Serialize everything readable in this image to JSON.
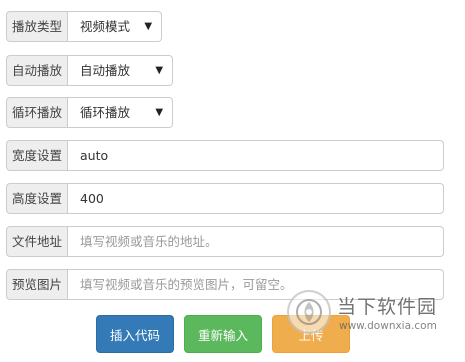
{
  "form": {
    "play_type": {
      "label": "播放类型",
      "value": "视频模式"
    },
    "autoplay": {
      "label": "自动播放",
      "value": "自动播放"
    },
    "loop": {
      "label": "循环播放",
      "value": "循环播放"
    },
    "width": {
      "label": "宽度设置",
      "value": "auto"
    },
    "height": {
      "label": "高度设置",
      "value": "400"
    },
    "file_url": {
      "label": "文件地址",
      "placeholder": "填写视频或音乐的地址。"
    },
    "preview_image": {
      "label": "预览图片",
      "placeholder": "填写视频或音乐的预览图片，可留空。"
    }
  },
  "buttons": {
    "insert": "插入代码",
    "reset": "重新输入",
    "upload": "上传"
  },
  "watermark": {
    "brand": "当下软件园",
    "url": "www.downxia.com"
  },
  "colors": {
    "primary": "#337ab7",
    "success": "#5cb85c",
    "warning": "#f0ad4e"
  },
  "icons": {
    "select_caret": "▼"
  }
}
